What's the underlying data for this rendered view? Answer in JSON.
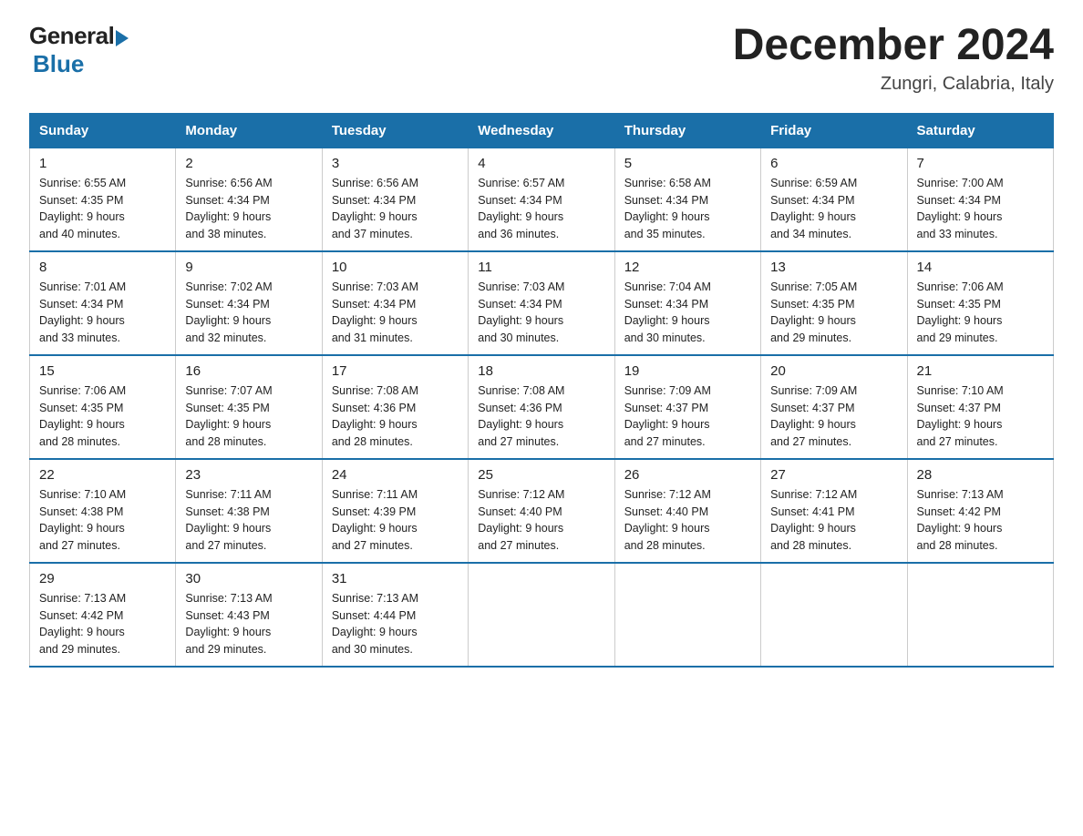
{
  "header": {
    "logo_general": "General",
    "logo_blue": "Blue",
    "month_year": "December 2024",
    "location": "Zungri, Calabria, Italy"
  },
  "days_of_week": [
    "Sunday",
    "Monday",
    "Tuesday",
    "Wednesday",
    "Thursday",
    "Friday",
    "Saturday"
  ],
  "weeks": [
    [
      {
        "day": "1",
        "sunrise": "6:55 AM",
        "sunset": "4:35 PM",
        "daylight": "9 hours and 40 minutes."
      },
      {
        "day": "2",
        "sunrise": "6:56 AM",
        "sunset": "4:34 PM",
        "daylight": "9 hours and 38 minutes."
      },
      {
        "day": "3",
        "sunrise": "6:56 AM",
        "sunset": "4:34 PM",
        "daylight": "9 hours and 37 minutes."
      },
      {
        "day": "4",
        "sunrise": "6:57 AM",
        "sunset": "4:34 PM",
        "daylight": "9 hours and 36 minutes."
      },
      {
        "day": "5",
        "sunrise": "6:58 AM",
        "sunset": "4:34 PM",
        "daylight": "9 hours and 35 minutes."
      },
      {
        "day": "6",
        "sunrise": "6:59 AM",
        "sunset": "4:34 PM",
        "daylight": "9 hours and 34 minutes."
      },
      {
        "day": "7",
        "sunrise": "7:00 AM",
        "sunset": "4:34 PM",
        "daylight": "9 hours and 33 minutes."
      }
    ],
    [
      {
        "day": "8",
        "sunrise": "7:01 AM",
        "sunset": "4:34 PM",
        "daylight": "9 hours and 33 minutes."
      },
      {
        "day": "9",
        "sunrise": "7:02 AM",
        "sunset": "4:34 PM",
        "daylight": "9 hours and 32 minutes."
      },
      {
        "day": "10",
        "sunrise": "7:03 AM",
        "sunset": "4:34 PM",
        "daylight": "9 hours and 31 minutes."
      },
      {
        "day": "11",
        "sunrise": "7:03 AM",
        "sunset": "4:34 PM",
        "daylight": "9 hours and 30 minutes."
      },
      {
        "day": "12",
        "sunrise": "7:04 AM",
        "sunset": "4:34 PM",
        "daylight": "9 hours and 30 minutes."
      },
      {
        "day": "13",
        "sunrise": "7:05 AM",
        "sunset": "4:35 PM",
        "daylight": "9 hours and 29 minutes."
      },
      {
        "day": "14",
        "sunrise": "7:06 AM",
        "sunset": "4:35 PM",
        "daylight": "9 hours and 29 minutes."
      }
    ],
    [
      {
        "day": "15",
        "sunrise": "7:06 AM",
        "sunset": "4:35 PM",
        "daylight": "9 hours and 28 minutes."
      },
      {
        "day": "16",
        "sunrise": "7:07 AM",
        "sunset": "4:35 PM",
        "daylight": "9 hours and 28 minutes."
      },
      {
        "day": "17",
        "sunrise": "7:08 AM",
        "sunset": "4:36 PM",
        "daylight": "9 hours and 28 minutes."
      },
      {
        "day": "18",
        "sunrise": "7:08 AM",
        "sunset": "4:36 PM",
        "daylight": "9 hours and 27 minutes."
      },
      {
        "day": "19",
        "sunrise": "7:09 AM",
        "sunset": "4:37 PM",
        "daylight": "9 hours and 27 minutes."
      },
      {
        "day": "20",
        "sunrise": "7:09 AM",
        "sunset": "4:37 PM",
        "daylight": "9 hours and 27 minutes."
      },
      {
        "day": "21",
        "sunrise": "7:10 AM",
        "sunset": "4:37 PM",
        "daylight": "9 hours and 27 minutes."
      }
    ],
    [
      {
        "day": "22",
        "sunrise": "7:10 AM",
        "sunset": "4:38 PM",
        "daylight": "9 hours and 27 minutes."
      },
      {
        "day": "23",
        "sunrise": "7:11 AM",
        "sunset": "4:38 PM",
        "daylight": "9 hours and 27 minutes."
      },
      {
        "day": "24",
        "sunrise": "7:11 AM",
        "sunset": "4:39 PM",
        "daylight": "9 hours and 27 minutes."
      },
      {
        "day": "25",
        "sunrise": "7:12 AM",
        "sunset": "4:40 PM",
        "daylight": "9 hours and 27 minutes."
      },
      {
        "day": "26",
        "sunrise": "7:12 AM",
        "sunset": "4:40 PM",
        "daylight": "9 hours and 28 minutes."
      },
      {
        "day": "27",
        "sunrise": "7:12 AM",
        "sunset": "4:41 PM",
        "daylight": "9 hours and 28 minutes."
      },
      {
        "day": "28",
        "sunrise": "7:13 AM",
        "sunset": "4:42 PM",
        "daylight": "9 hours and 28 minutes."
      }
    ],
    [
      {
        "day": "29",
        "sunrise": "7:13 AM",
        "sunset": "4:42 PM",
        "daylight": "9 hours and 29 minutes."
      },
      {
        "day": "30",
        "sunrise": "7:13 AM",
        "sunset": "4:43 PM",
        "daylight": "9 hours and 29 minutes."
      },
      {
        "day": "31",
        "sunrise": "7:13 AM",
        "sunset": "4:44 PM",
        "daylight": "9 hours and 30 minutes."
      },
      null,
      null,
      null,
      null
    ]
  ],
  "labels": {
    "sunrise_prefix": "Sunrise: ",
    "sunset_prefix": "Sunset: ",
    "daylight_prefix": "Daylight: "
  }
}
